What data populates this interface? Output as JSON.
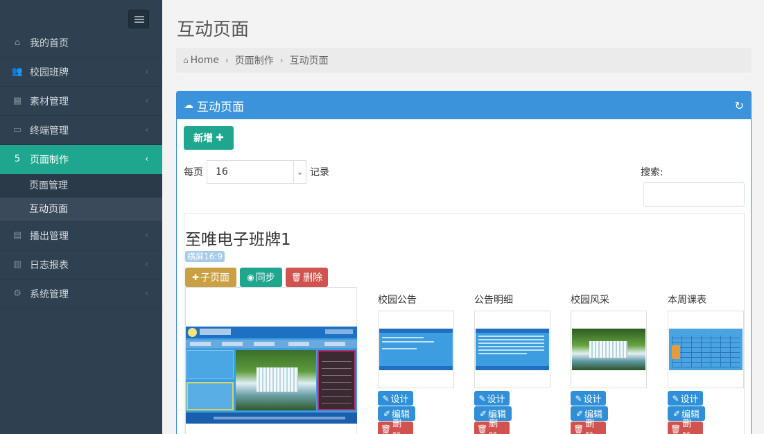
{
  "sidebar": {
    "toggle_icon": "hamburger-icon",
    "items": [
      {
        "label": "我的首页",
        "icon": "home-icon"
      },
      {
        "label": "校园班牌",
        "icon": "users-icon"
      },
      {
        "label": "素材管理",
        "icon": "grid-icon"
      },
      {
        "label": "终端管理",
        "icon": "monitor-icon"
      },
      {
        "label": "页面制作",
        "icon": "html5-icon"
      },
      {
        "label": "播出管理",
        "icon": "calendar-icon"
      },
      {
        "label": "日志报表",
        "icon": "bar-chart-icon"
      },
      {
        "label": "系统管理",
        "icon": "gears-icon"
      }
    ],
    "sub_items": [
      {
        "label": "页面管理"
      },
      {
        "label": "互动页面"
      }
    ],
    "active_color": "#1fa68e"
  },
  "header": {
    "title": "互动页面",
    "breadcrumb": [
      "Home",
      "页面制作",
      "互动页面"
    ]
  },
  "panel": {
    "title": "互动页面",
    "add_button": "新增",
    "per_page_label": "每页",
    "per_page_value": "16",
    "records_label": "记录",
    "search_label": "搜索:",
    "search_value": "",
    "header_color": "#3a93db"
  },
  "device": {
    "name": "至唯电子班牌1",
    "ratio_badge": "横屏16:9",
    "buttons": {
      "sub_page": "子页面",
      "sync": "同步",
      "delete": "删除"
    },
    "sub_pages": [
      {
        "label": "校园公告",
        "design": "设计",
        "edit": "编辑",
        "delete": "删除"
      },
      {
        "label": "公告明细",
        "design": "设计",
        "edit": "编辑",
        "delete": "删除"
      },
      {
        "label": "校园风采",
        "design": "设计",
        "edit": "编辑",
        "delete": "删除"
      },
      {
        "label": "本周课表",
        "design": "设计",
        "edit": "编辑",
        "delete": "删除"
      }
    ]
  }
}
